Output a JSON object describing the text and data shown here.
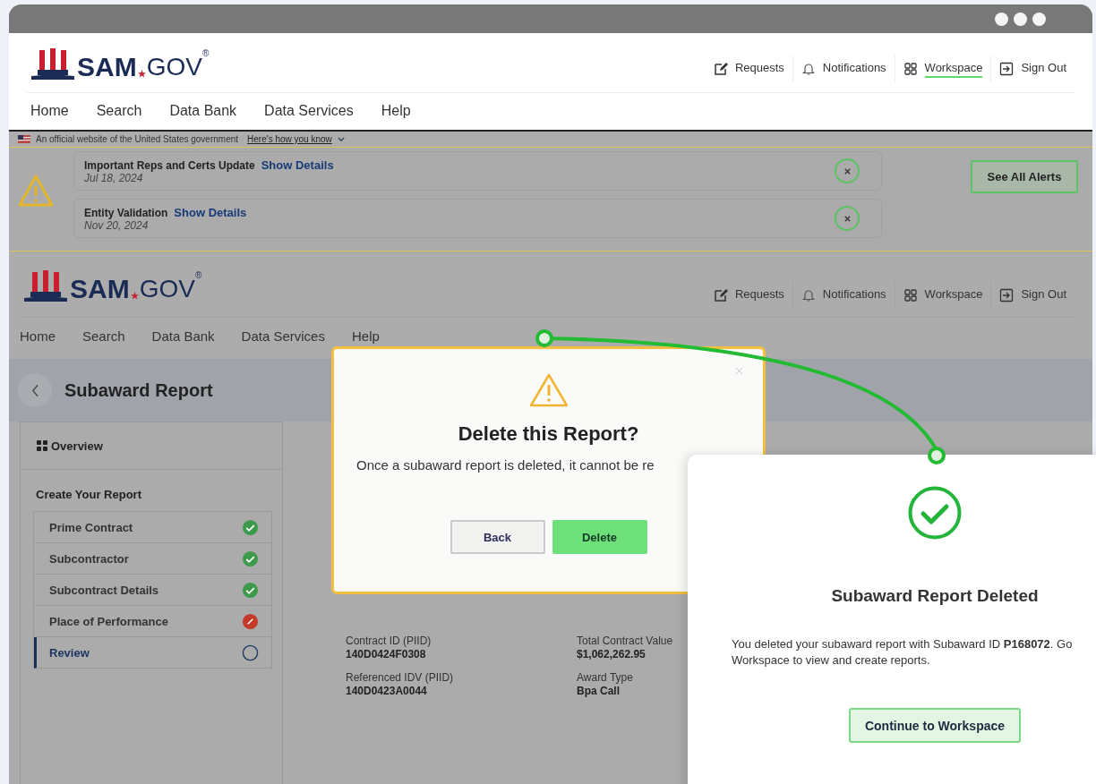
{
  "header": {
    "logo": {
      "name": "SAM",
      "suffix": "GOV",
      "mark": "®"
    },
    "links": [
      {
        "label": "Requests",
        "selected": false
      },
      {
        "label": "Notifications",
        "selected": false
      },
      {
        "label": "Workspace",
        "selected": true
      },
      {
        "label": "Sign Out",
        "selected": false
      }
    ],
    "nav": [
      "Home",
      "Search",
      "Data Bank",
      "Data Services",
      "Help"
    ]
  },
  "gov_banner": {
    "text": "An official website of the United States government",
    "link": "Here's how you know"
  },
  "alerts": {
    "items": [
      {
        "title": "Important Reps and Certs Update",
        "link": "Show Details",
        "date": "Jul 18, 2024"
      },
      {
        "title": "Entity Validation",
        "link": "Show Details",
        "date": "Nov 20, 2024"
      }
    ],
    "see_all": "See All Alerts"
  },
  "page_header": {
    "logo": {
      "name": "SAM",
      "suffix": "GOV",
      "mark": "®"
    },
    "links": [
      {
        "label": "Requests",
        "selected": false
      },
      {
        "label": "Notifications",
        "selected": false
      },
      {
        "label": "Workspace",
        "selected": false
      },
      {
        "label": "Sign Out",
        "selected": false
      }
    ],
    "nav": [
      "Home",
      "Search",
      "Data Bank",
      "Data Services",
      "Help"
    ]
  },
  "page_title": "Subaward Report",
  "sidebar": {
    "overview": "Overview",
    "section": "Create Your Report",
    "items": [
      {
        "label": "Prime Contract",
        "kind": "complete",
        "selected": false
      },
      {
        "label": "Subcontractor",
        "kind": "complete",
        "selected": false
      },
      {
        "label": "Subcontract Details",
        "kind": "complete",
        "selected": false
      },
      {
        "label": "Place of Performance",
        "kind": "error",
        "selected": false
      },
      {
        "label": "Review",
        "kind": "pending",
        "selected": true
      }
    ]
  },
  "fields": [
    {
      "label": "Contract ID (PIID)",
      "value": "140D0424F0308"
    },
    {
      "label": "Total Contract Value",
      "value": "$1,062,262.95"
    },
    {
      "label": "Referenced IDV (PIID)",
      "value": "140D0423A0044"
    },
    {
      "label": "Award Type",
      "value": "Bpa Call"
    }
  ],
  "delete_dialog": {
    "title": "Delete this Report?",
    "message": "Once a subaward report is deleted, it cannot be re",
    "buttons": [
      {
        "label": "Back",
        "kind": "secondary"
      },
      {
        "label": "Delete",
        "kind": "primary"
      }
    ]
  },
  "success_panel": {
    "title": "Subaward Report Deleted",
    "lines": [
      "You deleted your subaward report with Subaward ID **P168072**. Go",
      "Workspace to view and create reports."
    ],
    "button": "Continue to Workspace"
  }
}
